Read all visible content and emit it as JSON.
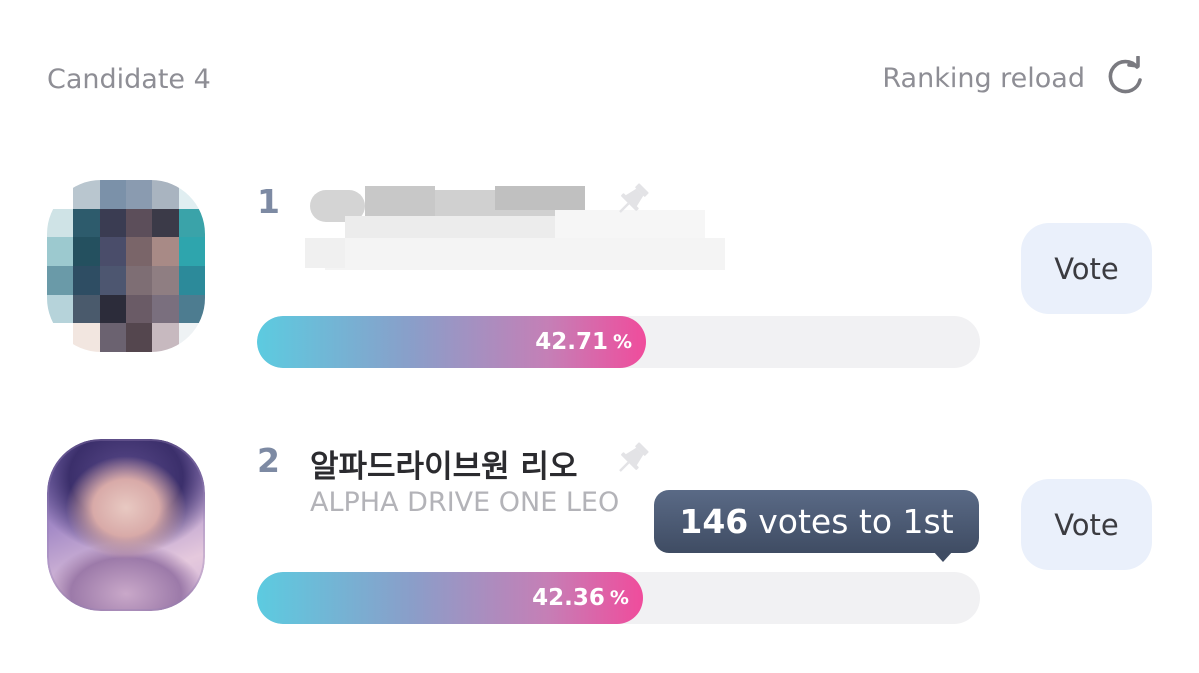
{
  "header": {
    "candidate_label": "Candidate 4",
    "reload_label": "Ranking reload",
    "reload_icon": "refresh-icon"
  },
  "candidates": [
    {
      "rank": "1",
      "name": "",
      "subname": "",
      "name_redacted": true,
      "vote_label": "Vote",
      "percent": "42.71",
      "percent_unit": "%",
      "bar_fraction": 0.4271,
      "pin_icon": "pin-icon"
    },
    {
      "rank": "2",
      "name": "알파드라이브원 리오",
      "subname": "ALPHA DRIVE ONE LEO",
      "vote_label": "Vote",
      "percent": "42.36",
      "percent_unit": "%",
      "bar_fraction": 0.4236,
      "pin_icon": "pin-icon",
      "tooltip": {
        "count": "146",
        "text": "votes to 1st"
      }
    }
  ],
  "colors": {
    "bar_start": "#5ccbe0",
    "bar_end": "#f04c9c",
    "track": "#f1f1f3",
    "vote_bg": "#eaf0fb",
    "rank": "#7d8aa3",
    "tooltip_bg": "#47546c"
  }
}
